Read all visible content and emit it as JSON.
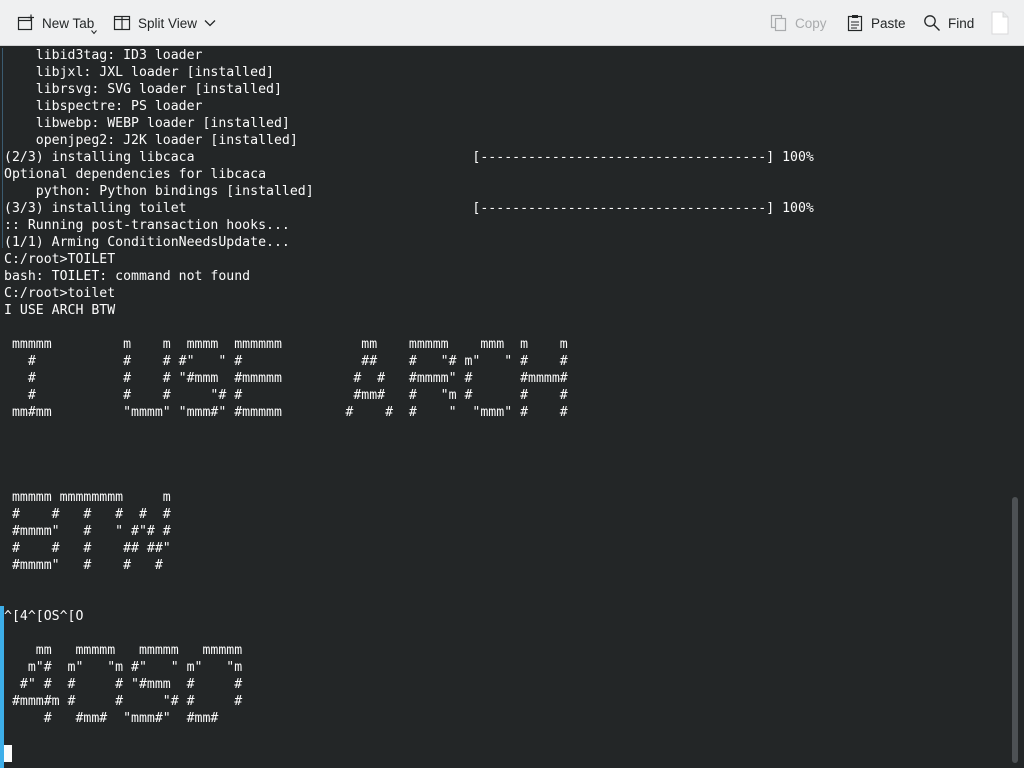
{
  "toolbar": {
    "new_tab_label": "New Tab",
    "split_view_label": "Split View",
    "copy_label": "Copy",
    "paste_label": "Paste",
    "find_label": "Find"
  },
  "terminal": {
    "lines": [
      "    libid3tag: ID3 loader",
      "    libjxl: JXL loader [installed]",
      "    librsvg: SVG loader [installed]",
      "    libspectre: PS loader",
      "    libwebp: WEBP loader [installed]",
      "    openjpeg2: J2K loader [installed]",
      "(2/3) installing libcaca                                   [------------------------------------] 100%",
      "Optional dependencies for libcaca",
      "    python: Python bindings [installed]",
      "(3/3) installing toilet                                    [------------------------------------] 100%",
      ":: Running post-transaction hooks...",
      "(1/1) Arming ConditionNeedsUpdate...",
      "C:/root>TOILET",
      "bash: TOILET: command not found",
      "C:/root>toilet",
      "I USE ARCH BTW",
      "",
      " mmmmm         m    m  mmmm  mmmmmm          mm    mmmmm    mmm  m    m",
      "   #           #    # #\"   \" #               ##    #   \"# m\"   \" #    #",
      "   #           #    # \"#mmm  #mmmmm         #  #   #mmmm\" #      #mmmm#",
      "   #           #    #     \"# #              #mm#   #   \"m #      #    #",
      " mm#mm         \"mmmm\" \"mmm#\" #mmmmm        #    #  #    \"  \"mmm\" #    #",
      "",
      "",
      "",
      "",
      " mmmmm mmmmmmmm     m",
      " #    #   #   #  #  #",
      " #mmmm\"   #   \" #\"# #",
      " #    #   #    ## ##\"",
      " #mmmm\"   #    #   #",
      "",
      "",
      "^[4^[OS^[O",
      "",
      "    mm   mmmmm   mmmmm   mmmmm",
      "   m\"#  m\"   \"m #\"   \" m\"   \"m",
      "  #\" #  #     # \"#mmm  #     #",
      " #mmm#m #     #     \"# #     #",
      "     #   #mm#  \"mmm#\"  #mm#"
    ]
  }
}
